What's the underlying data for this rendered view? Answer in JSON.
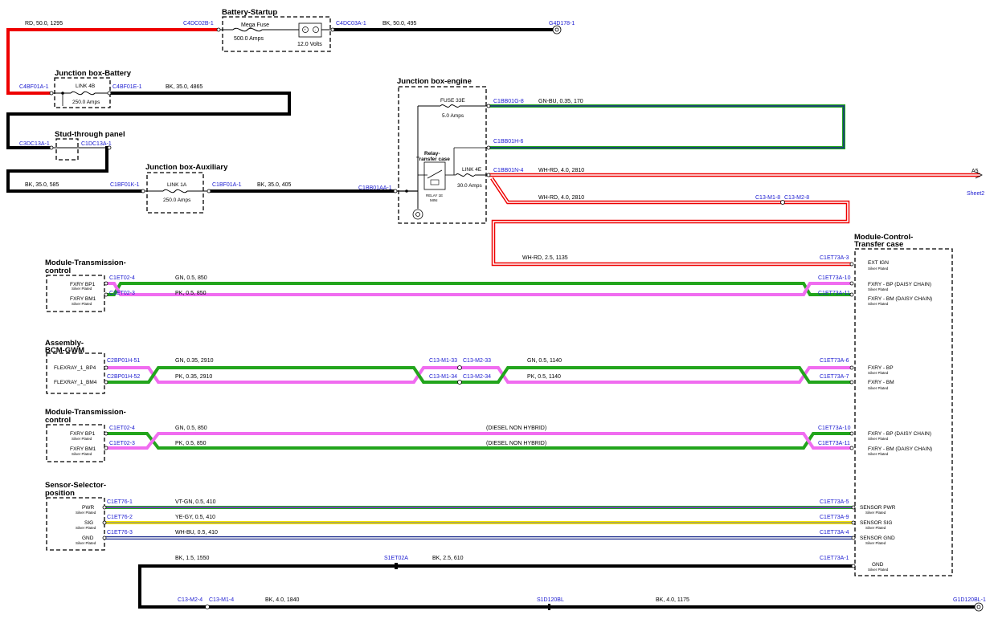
{
  "colors": {
    "BK": "#000000",
    "RD": "#ee0000",
    "GN": "#22a51c",
    "PK": "#f06cf0",
    "BU": "#1a2a8c",
    "WH": "#ffffff",
    "VT": "#8a2be2",
    "YE": "#f5e400"
  },
  "components": {
    "battery_startup": {
      "title": "Battery-Startup",
      "fuse_label": "Mega Fuse",
      "fuse_rating": "500.0 Amps",
      "battery_label": "12.0 Volts"
    },
    "jb_battery": {
      "title": "Junction box-Battery",
      "link_label": "LINK 4B",
      "link_rating": "250.0 Amps"
    },
    "stud_panel": {
      "title": "Stud-through panel"
    },
    "jb_aux": {
      "title": "Junction box-Auxiliary",
      "link_label": "LINK 1A",
      "link_rating": "250.0 Amps"
    },
    "jb_engine": {
      "title": "Junction box-engine",
      "fuse_label": "FUSE 33E",
      "fuse_rating": "5.0 Amps",
      "relay_title": "Relay-Transfer case",
      "relay_label": "RELAY 1E",
      "relay_sub": "MINI",
      "link_label": "LINK 4E",
      "link_rating": "30.0 Amps"
    },
    "mcc": {
      "title_line1": "Module-Control-",
      "title_line2": "Transfer case",
      "pins": [
        {
          "name": "EXT IGN",
          "note": "Silver Plated"
        },
        {
          "name": "FXRY - BP (DAISY CHAIN)",
          "note": "Silver Plated"
        },
        {
          "name": "FXRY - BM (DAISY CHAIN)",
          "note": "Silver Plated"
        },
        {
          "name": "FXRY - BP",
          "note": "Silver Plated"
        },
        {
          "name": "FXRY - BM",
          "note": "Silver Plated"
        },
        {
          "name": "FXRY - BP (DAISY CHAIN)",
          "note": "Silver Plated"
        },
        {
          "name": "FXRY - BM (DAISY CHAIN)",
          "note": "Silver Plated"
        },
        {
          "name": "SENSOR PWR",
          "note": "Silver Plated"
        },
        {
          "name": "SENSOR SIG",
          "note": "Silver Plated"
        },
        {
          "name": "SENSOR GND",
          "note": "Silver Plated"
        },
        {
          "name": "GND",
          "note": "Silver Plated"
        }
      ]
    },
    "tcm1": {
      "title_line1": "Module-Transmission-",
      "title_line2": "control",
      "pins": [
        {
          "name": "FXRY BP1",
          "note": "Silver Plated"
        },
        {
          "name": "FXRY BM1",
          "note": "Silver Plated"
        }
      ]
    },
    "bcm": {
      "title_line1": "Assembly-",
      "title_line2": "BCM-GWM",
      "pins": [
        {
          "name": "FLEXRAY_1_BP4",
          "note": ""
        },
        {
          "name": "FLEXRAY_1_BM4",
          "note": ""
        }
      ]
    },
    "tcm2": {
      "title_line1": "Module-Transmission-",
      "title_line2": "control",
      "pins": [
        {
          "name": "FXRY BP1",
          "note": "Silver Plated"
        },
        {
          "name": "FXRY BM1",
          "note": "Silver Plated"
        }
      ]
    },
    "sensor": {
      "title_line1": "Sensor-Selector-",
      "title_line2": "position",
      "pins": [
        {
          "name": "PWR",
          "note": "Silver Plated"
        },
        {
          "name": "SIG",
          "note": "Silver Plated"
        },
        {
          "name": "GND",
          "note": "Silver Plated"
        }
      ]
    }
  },
  "connectors": {
    "c4dc02b": "C4DC02B-1",
    "c4dc03a": "C4DC03A-1",
    "g4d178": "G4D178-1",
    "c4bf01a": "C4BF01A-1",
    "c4bf01e": "C4BF01E-1",
    "c3dc13a": "C3DC13A-1",
    "c1dc13a": "C1DC13A-1",
    "c1bf01k": "C1BF01K-1",
    "c1bf01a": "C1BF01A-1",
    "c1bb01aa": "C1BB01AA-1",
    "c1bb01g": "C1BB01G-8",
    "c1bb01h": "C1BB01H-6",
    "c1bb01n": "C1BB01N-4",
    "c13m18": "C13-M1-8",
    "c13m28": "C13-M2-8",
    "sheet_ref": "A5",
    "sheet_name": "Sheet2",
    "c1et73a3": "C1ET73A-3",
    "c1et02_4a": "C1ET02-4",
    "c1et02_3a": "C1ET02-3",
    "c1et73a10a": "C1ET73A-10",
    "c1et73a11a": "C1ET73A-11",
    "c2bp01h51": "C2BP01H-51",
    "c2bp01h52": "C2BP01H-52",
    "c13m133": "C13-M1-33",
    "c13m233": "C13-M2-33",
    "c13m134": "C13-M1-34",
    "c13m234": "C13-M2-34",
    "c1et73a6": "C1ET73A-6",
    "c1et73a7": "C1ET73A-7",
    "c1et02_4b": "C1ET02-4",
    "c1et02_3b": "C1ET02-3",
    "c1et73a10b": "C1ET73A-10",
    "c1et73a11b": "C1ET73A-11",
    "c1et76_1": "C1ET76-1",
    "c1et76_2": "C1ET76-2",
    "c1et76_3": "C1ET76-3",
    "c1et73a5": "C1ET73A-5",
    "c1et73a9": "C1ET73A-9",
    "c1et73a4": "C1ET73A-4",
    "s1et02a": "S1ET02A",
    "c1et73a1": "C1ET73A-1",
    "c13m24": "C13-M2-4",
    "c13m14": "C13-M1-4",
    "s1d120bl": "S1D120BL",
    "g1d120bl": "G1D120BL-1"
  },
  "wires": {
    "w_rd_1295": "RD,  50.0,  1295",
    "w_bk_495": "BK,  50.0,  495",
    "w_bk_4865": "BK,  35.0,  4865",
    "w_bk_585": "BK,  35.0,  585",
    "w_bk_405": "BK,  35.0,  405",
    "w_gnbu_170": "GN-BU,  0.35,  170",
    "w_whrd_2810a": "WH-RD,  4.0,  2810",
    "w_whrd_2810b": "WH-RD,  4.0,  2810",
    "w_whrd_1135": "WH-RD,  2.5,  1135",
    "w_gn_850a": "GN,  0.5,  850",
    "w_pk_850a": "PK,  0.5,  850",
    "w_gn_2910": "GN,  0.35,  2910",
    "w_pk_2910": "PK,  0.35,  2910",
    "w_gn_1140": "GN,  0.5,  1140",
    "w_pk_1140": "PK,  0.5,  1140",
    "w_gn_850b": "GN,  0.5,  850",
    "w_pk_850b": "PK,  0.5,  850",
    "diesel_note_a": "(DIESEL NON HYBRID)",
    "diesel_note_b": "(DIESEL NON HYBRID)",
    "w_vtgn_410": "VT-GN,  0.5,  410",
    "w_yegy_410": "YE-GY,  0.5,  410",
    "w_whbu_410": "WH-BU,  0.5,  410",
    "w_bk_1550": "BK,  1.5,  1550",
    "w_bk_610": "BK,  2.5,  610",
    "w_bk_1840": "BK,  4.0,  1840",
    "w_bk_1175": "BK,  4.0,  1175"
  }
}
